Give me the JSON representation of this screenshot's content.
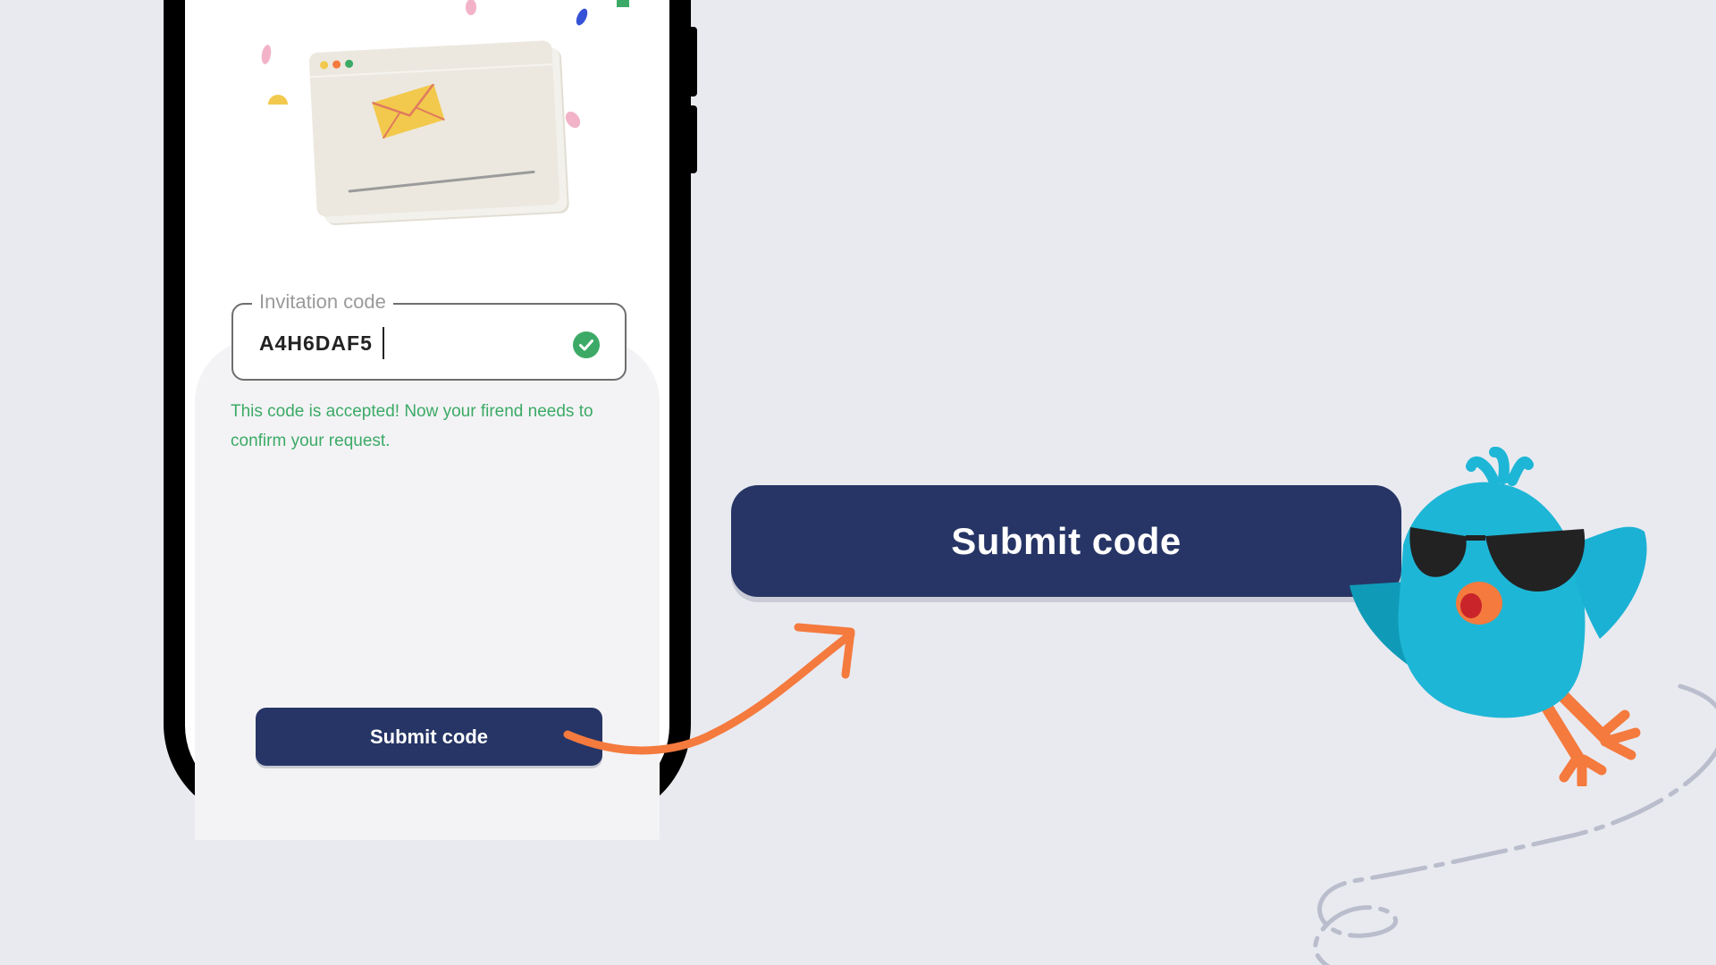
{
  "field": {
    "legend": "Invitation code",
    "value": "A4H6DAF5"
  },
  "helper_text": "This code is accepted! Now your firend needs to confirm your request.",
  "buttons": {
    "submit_small": "Submit code",
    "submit_big": "Submit code"
  },
  "colors": {
    "background": "#e9eaf0",
    "button": "#263565",
    "success": "#3caa66",
    "arrow": "#f47a3e",
    "bird": "#1eb6d6"
  },
  "icons": {
    "status": "check-circle-icon",
    "illustration": "envelope-window-illustration",
    "mascot": "bird-sunglasses-mascot",
    "pointer": "curved-arrow-icon"
  }
}
